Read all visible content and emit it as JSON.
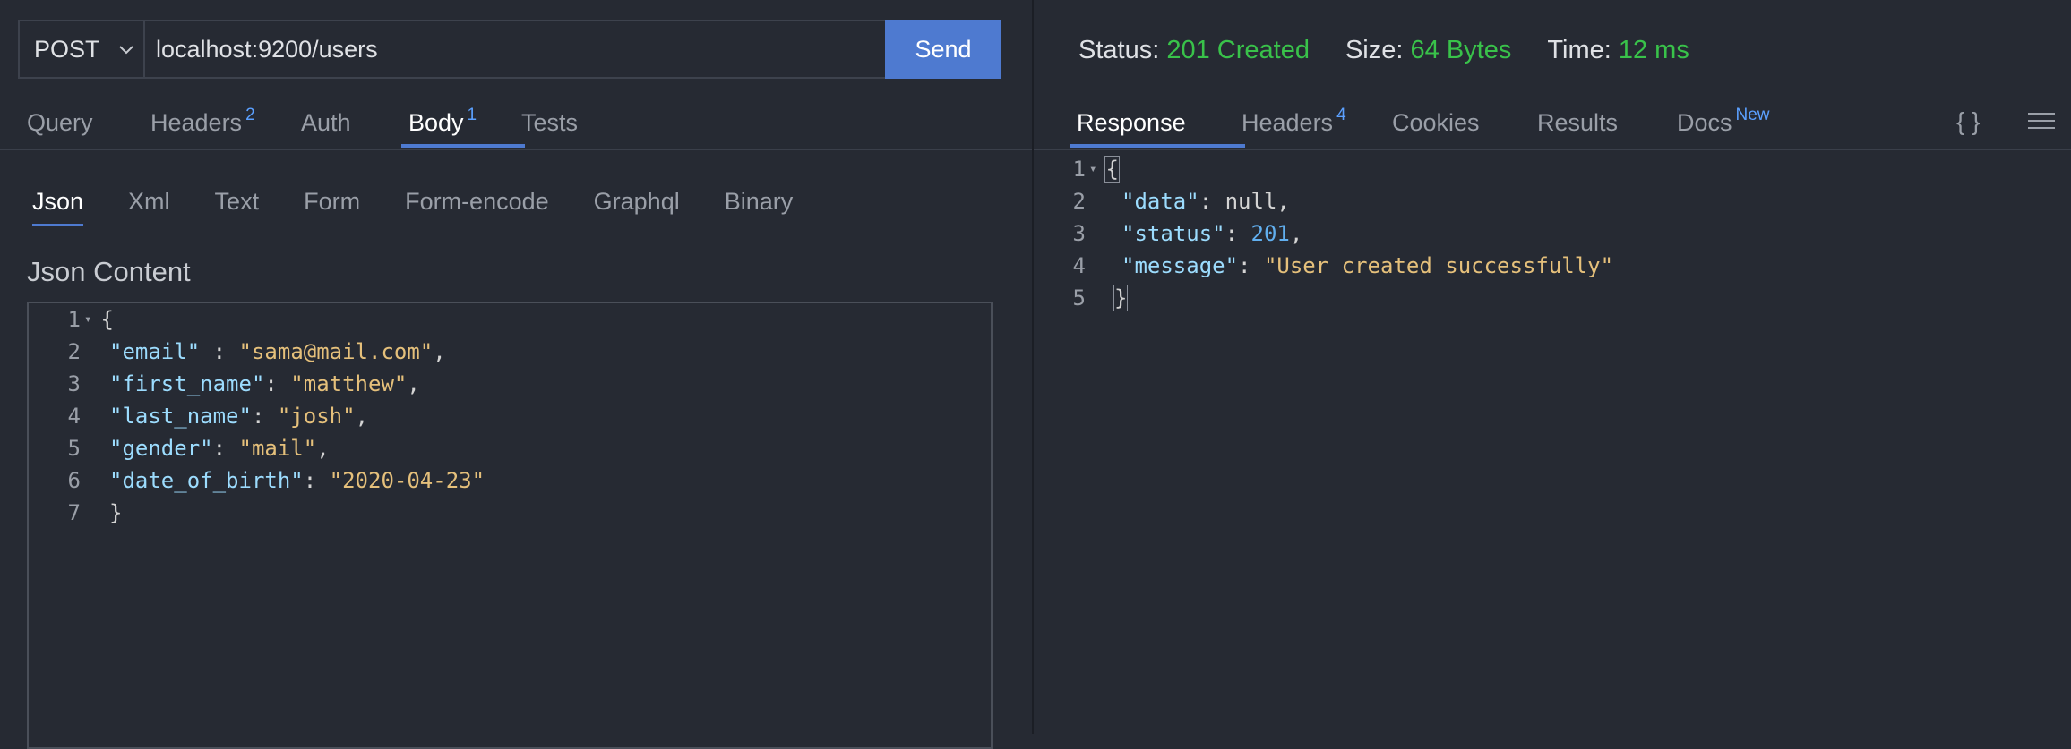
{
  "request": {
    "method": "POST",
    "url": "localhost:9200/users",
    "send_label": "Send",
    "tabs": [
      {
        "label": "Query",
        "badge": ""
      },
      {
        "label": "Headers",
        "badge": "2"
      },
      {
        "label": "Auth",
        "badge": ""
      },
      {
        "label": "Body",
        "badge": "1"
      },
      {
        "label": "Tests",
        "badge": ""
      }
    ],
    "active_tab": "Body",
    "body_types": [
      "Json",
      "Xml",
      "Text",
      "Form",
      "Form-encode",
      "Graphql",
      "Binary"
    ],
    "active_body_type": "Json",
    "content_label": "Json Content",
    "line_numbers": [
      "1",
      "2",
      "3",
      "4",
      "5",
      "6",
      "7"
    ],
    "json_lines": [
      "{",
      "    \"email\" : \"sama@mail.com\",",
      "    \"first_name\": \"matthew\",",
      "    \"last_name\": \"josh\",",
      "    \"gender\": \"mail\",",
      "    \"date_of_birth\": \"2020-04-23\"",
      "}"
    ]
  },
  "response": {
    "status_label": "Status:",
    "status_value": "201 Created",
    "size_label": "Size:",
    "size_value": "64 Bytes",
    "time_label": "Time:",
    "time_value": "12 ms",
    "tabs": [
      {
        "label": "Response",
        "badge": ""
      },
      {
        "label": "Headers",
        "badge": "4"
      },
      {
        "label": "Cookies",
        "badge": ""
      },
      {
        "label": "Results",
        "badge": ""
      },
      {
        "label": "Docs",
        "badge": "New"
      }
    ],
    "active_tab": "Response",
    "line_numbers": [
      "1",
      "2",
      "3",
      "4",
      "5"
    ],
    "json_lines": [
      "{",
      "  \"data\": null,",
      "  \"status\": 201,",
      "  \"message\": \"User created successfully\"",
      "}"
    ]
  },
  "icons": {
    "braces": "{ }",
    "method_dropdown": "chevron-down-icon",
    "format": "format-json-icon",
    "menu": "menu-icon"
  },
  "colors": {
    "background": "#262a33",
    "accent": "#4e7ad0",
    "status_ok": "#39c24a",
    "badge": "#5ba0ff",
    "json_key": "#9cdcfe",
    "json_string": "#e5c07b",
    "json_number": "#61afef"
  }
}
